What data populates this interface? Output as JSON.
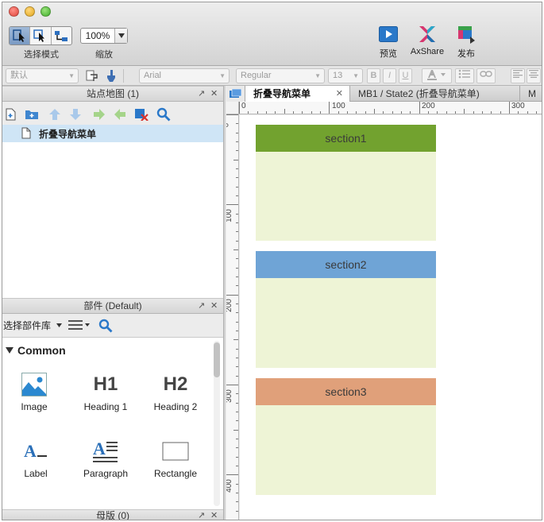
{
  "toolbar": {
    "mode_label": "选择模式",
    "zoom_label": "缩放",
    "zoom_value": "100%",
    "preview_label": "预览",
    "axshare_label": "AxShare",
    "publish_label": "发布"
  },
  "format_bar": {
    "style_select": "默认",
    "font_select": "Arial",
    "weight_select": "Regular",
    "size_select": "13",
    "bold": "B",
    "italic": "I",
    "underline": "U"
  },
  "sitemap": {
    "title": "站点地图 (1)",
    "pages": [
      "折叠导航菜单"
    ]
  },
  "widgets": {
    "title": "部件 (Default)",
    "library_select": "选择部件库",
    "category": "Common",
    "items": [
      "Image",
      "Heading 1",
      "Heading 2",
      "Label",
      "Paragraph",
      "Rectangle"
    ],
    "h1_glyph": "H1",
    "h2_glyph": "H2"
  },
  "masters": {
    "title": "母版 (0)"
  },
  "tabs": [
    "折叠导航菜单",
    "MB1 / State2 (折叠导航菜单)",
    "M"
  ],
  "rulers": {
    "top": [
      "0",
      "100",
      "200",
      "300"
    ],
    "left": [
      "0",
      "100",
      "200",
      "300",
      "400"
    ]
  },
  "canvas": {
    "sections": [
      {
        "label": "section1",
        "color": "#72a22f"
      },
      {
        "label": "section2",
        "color": "#6fa4d6"
      },
      {
        "label": "section3",
        "color": "#e0a07a"
      }
    ],
    "body_color": "#eef4d6"
  }
}
